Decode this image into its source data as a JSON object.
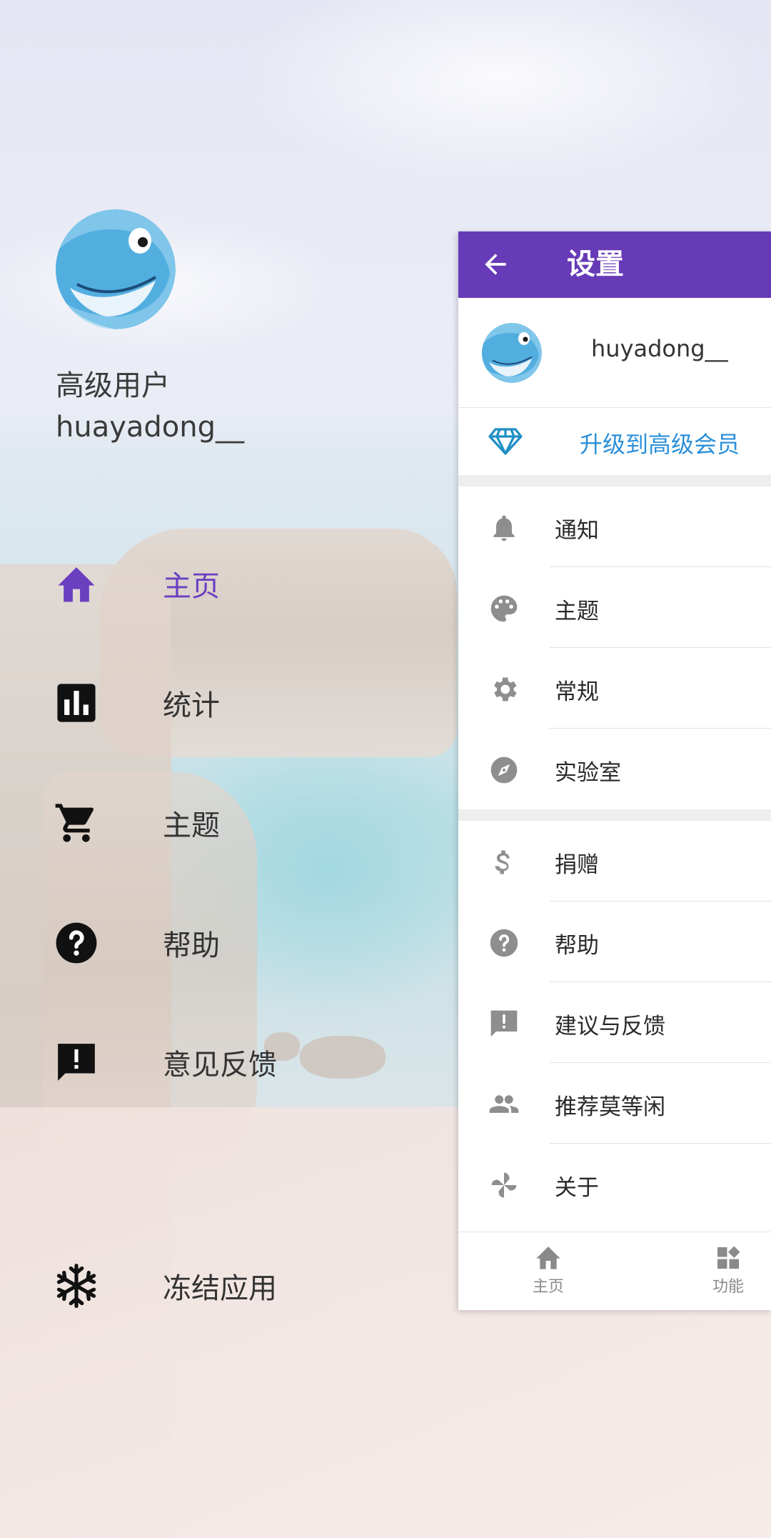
{
  "drawer": {
    "user_level": "高级用户",
    "username": "huayadong__",
    "nav_items": [
      {
        "label": "主页",
        "icon": "home-icon",
        "active": true
      },
      {
        "label": "统计",
        "icon": "bar-chart-icon",
        "active": false
      },
      {
        "label": "主题",
        "icon": "cart-icon",
        "active": false
      },
      {
        "label": "帮助",
        "icon": "help-icon",
        "active": false
      },
      {
        "label": "意见反馈",
        "icon": "feedback-icon",
        "active": false
      },
      {
        "label": "冻结应用",
        "icon": "snowflake-icon",
        "active": false
      }
    ]
  },
  "settings": {
    "title": "设置",
    "profile_name": "huyadong__",
    "upgrade_label": "升级到高级会员",
    "group1": [
      {
        "label": "通知",
        "icon": "bell-icon"
      },
      {
        "label": "主题",
        "icon": "palette-icon"
      },
      {
        "label": "常规",
        "icon": "gear-icon"
      },
      {
        "label": "实验室",
        "icon": "compass-icon"
      }
    ],
    "group2": [
      {
        "label": "捐赠",
        "icon": "dollar-icon"
      },
      {
        "label": "帮助",
        "icon": "help-icon"
      },
      {
        "label": "建议与反馈",
        "icon": "feedback-icon"
      },
      {
        "label": "推荐莫等闲",
        "icon": "people-icon"
      },
      {
        "label": "关于",
        "icon": "pinwheel-icon"
      }
    ],
    "bottom_tabs": [
      {
        "label": "主页",
        "icon": "home-icon"
      },
      {
        "label": "功能",
        "icon": "widgets-icon"
      }
    ]
  },
  "colors": {
    "accent": "#673ab7",
    "active_nav": "#6a3fc0",
    "upgrade_link": "#2b8fd9",
    "icon_gray": "#8e8e8e"
  }
}
